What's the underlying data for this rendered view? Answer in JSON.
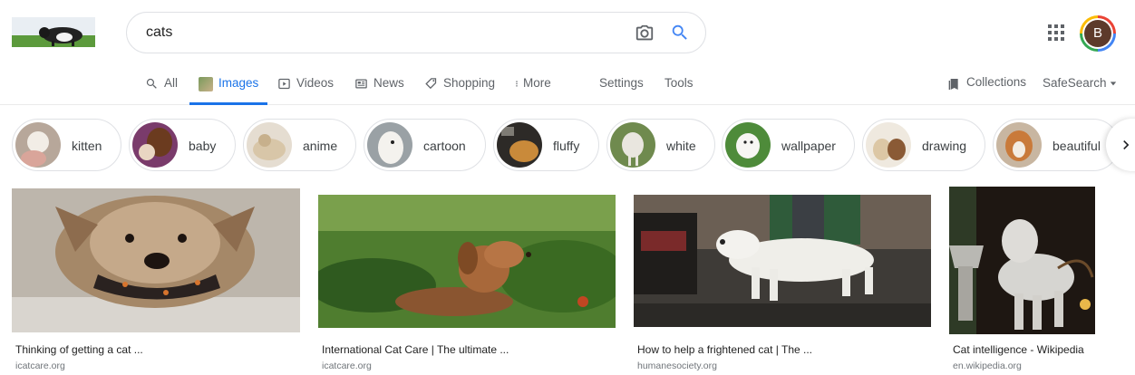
{
  "search": {
    "query": "cats"
  },
  "account": {
    "avatar_letter": "B"
  },
  "tabs": [
    {
      "label": "All",
      "icon": "search-icon",
      "active": false
    },
    {
      "label": "Images",
      "icon": "image-thumb-icon",
      "active": true
    },
    {
      "label": "Videos",
      "icon": "play-icon",
      "active": false
    },
    {
      "label": "News",
      "icon": "news-icon",
      "active": false
    },
    {
      "label": "Shopping",
      "icon": "tag-icon",
      "active": false
    },
    {
      "label": "More",
      "icon": "more-vert-icon",
      "active": false
    },
    {
      "label": "Settings"
    },
    {
      "label": "Tools"
    }
  ],
  "right_tools": {
    "collections": "Collections",
    "safesearch": "SafeSearch"
  },
  "chips": [
    {
      "label": "kitten"
    },
    {
      "label": "baby"
    },
    {
      "label": "anime"
    },
    {
      "label": "cartoon"
    },
    {
      "label": "fluffy"
    },
    {
      "label": "white"
    },
    {
      "label": "wallpaper"
    },
    {
      "label": "drawing"
    },
    {
      "label": "beautiful"
    }
  ],
  "results": [
    {
      "title": "Thinking of getting a cat ...",
      "source": "icatcare.org"
    },
    {
      "title": "International Cat Care | The ultimate ...",
      "source": "icatcare.org"
    },
    {
      "title": "How to help a frightened cat | The ...",
      "source": "humanesociety.org"
    },
    {
      "title": "Cat intelligence - Wikipedia",
      "source": "en.wikipedia.org"
    }
  ],
  "colors": {
    "accent": "#1a73e8",
    "text_secondary": "#5f6368",
    "border": "#dfe1e5"
  }
}
